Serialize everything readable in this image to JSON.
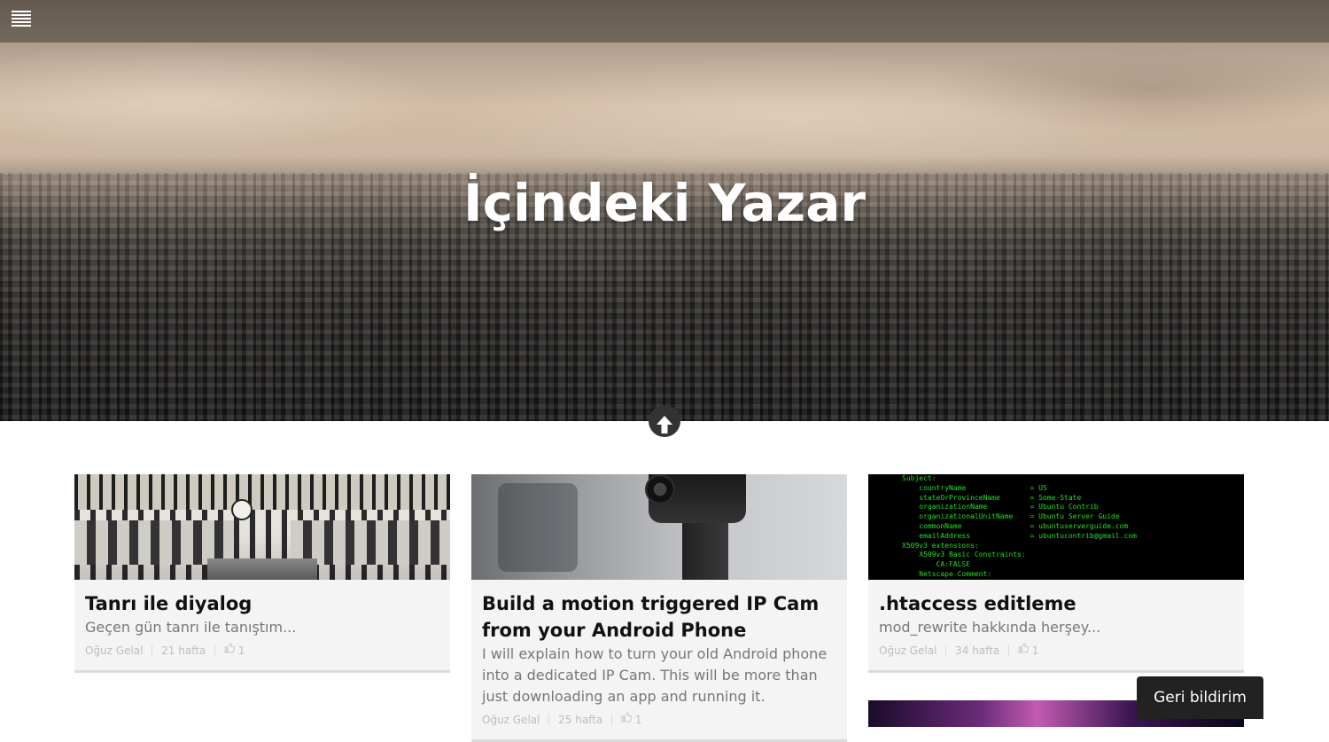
{
  "site": {
    "title": "İçindeki Yazar"
  },
  "header": {
    "menu_icon": "hamburger-menu-icon",
    "scroll_up_icon": "arrow-up-icon"
  },
  "posts": [
    {
      "title": "Tanrı ile diyalog",
      "excerpt": "Geçen gün tanrı ile tanıştım...",
      "author": "Oğuz Gelal",
      "age": "21 hafta",
      "likes": "1",
      "thumbnail": "train-station-image"
    },
    {
      "title": "Build a motion triggered IP Cam from your Android Phone",
      "excerpt": "I will explain how to turn your old Android phone into a dedicated IP Cam. This will be more than just downloading an app and running it.",
      "author": "Oğuz Gelal",
      "age": "25 hafta",
      "likes": "1",
      "thumbnail": "ip-camera-image"
    },
    {
      "title": ".htaccess editleme",
      "excerpt": "mod_rewrite hakkında herşey...",
      "author": "Oğuz Gelal",
      "age": "34 hafta",
      "likes": "1",
      "thumbnail": "terminal-output-image",
      "terminal_lines": [
        "Subject:",
        "    countryName               = US",
        "    stateOrProvinceName       = Some-State",
        "    organizationName          = Ubuntu Contrib",
        "    organizationalUnitName    = Ubuntu Server Guide",
        "    commonName                = ubuntuserverguide.com",
        "    emailAddress              = ubuntucontrib@gmail.com",
        "X509v3 extensions:",
        "    X509v3 Basic Constraints:",
        "        CA:FALSE",
        "    Netscape Comment:"
      ]
    }
  ],
  "feedback": {
    "label": "Geri bildirim"
  },
  "colors": {
    "title_text": "#ffffff",
    "card_bg": "#f4f4f4",
    "terminal_text": "#1fe21f",
    "feedback_bg": "#222222"
  }
}
